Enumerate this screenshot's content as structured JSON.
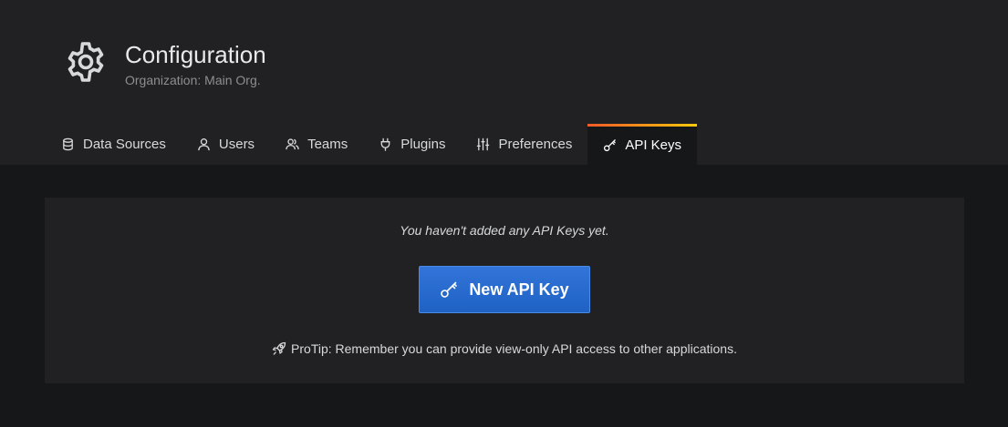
{
  "header": {
    "title": "Configuration",
    "subtitle": "Organization: Main Org.",
    "icon": "gear-icon"
  },
  "tabs": [
    {
      "label": "Data Sources",
      "icon": "database-icon",
      "active": false
    },
    {
      "label": "Users",
      "icon": "user-icon",
      "active": false
    },
    {
      "label": "Teams",
      "icon": "users-icon",
      "active": false
    },
    {
      "label": "Plugins",
      "icon": "plug-icon",
      "active": false
    },
    {
      "label": "Preferences",
      "icon": "sliders-icon",
      "active": false
    },
    {
      "label": "API Keys",
      "icon": "key-icon",
      "active": true
    }
  ],
  "empty_state": {
    "message": "You haven't added any API Keys yet.",
    "button_label": "New API Key",
    "button_icon": "key-icon",
    "protip": "ProTip: Remember you can provide view-only API access to other applications.",
    "protip_icon": "rocket-icon"
  },
  "colors": {
    "primary_button": "#3274d9",
    "active_tab_gradient_start": "#f05a28",
    "active_tab_gradient_end": "#fbca0a",
    "background": "#161719",
    "panel": "#212124"
  }
}
